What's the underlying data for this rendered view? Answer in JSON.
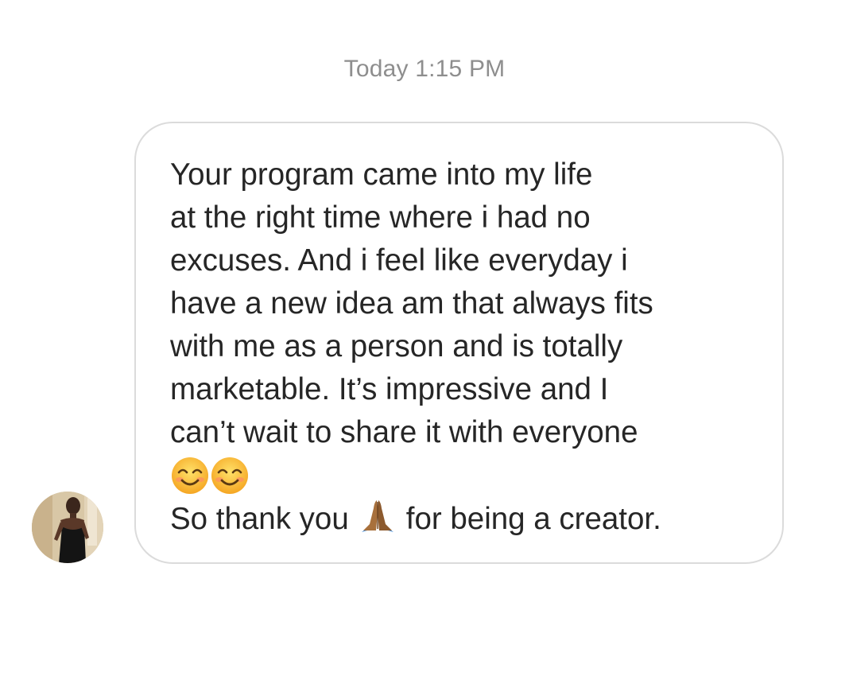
{
  "thread": {
    "timestamp": "Today 1:15 PM",
    "message": {
      "lines": [
        "Your program came into my life",
        "at the right time where i had no",
        "excuses. And i feel like everyday i",
        "have a new idea am that always fits",
        "with me as a person and is totally",
        "marketable. It’s impressive and I",
        "can’t wait to share it with everyone"
      ],
      "emoji_line": [
        "smiling-face-with-smiling-eyes",
        "smiling-face-with-smiling-eyes"
      ],
      "closing_before": "So thank you",
      "closing_emoji": "folded-hands",
      "closing_after": "for being a creator."
    },
    "sender_avatar": "avatar"
  },
  "colors": {
    "background": "#ffffff",
    "timestamp": "#8e8e8e",
    "bubble_border": "#dbdbdb",
    "text": "#262626"
  }
}
